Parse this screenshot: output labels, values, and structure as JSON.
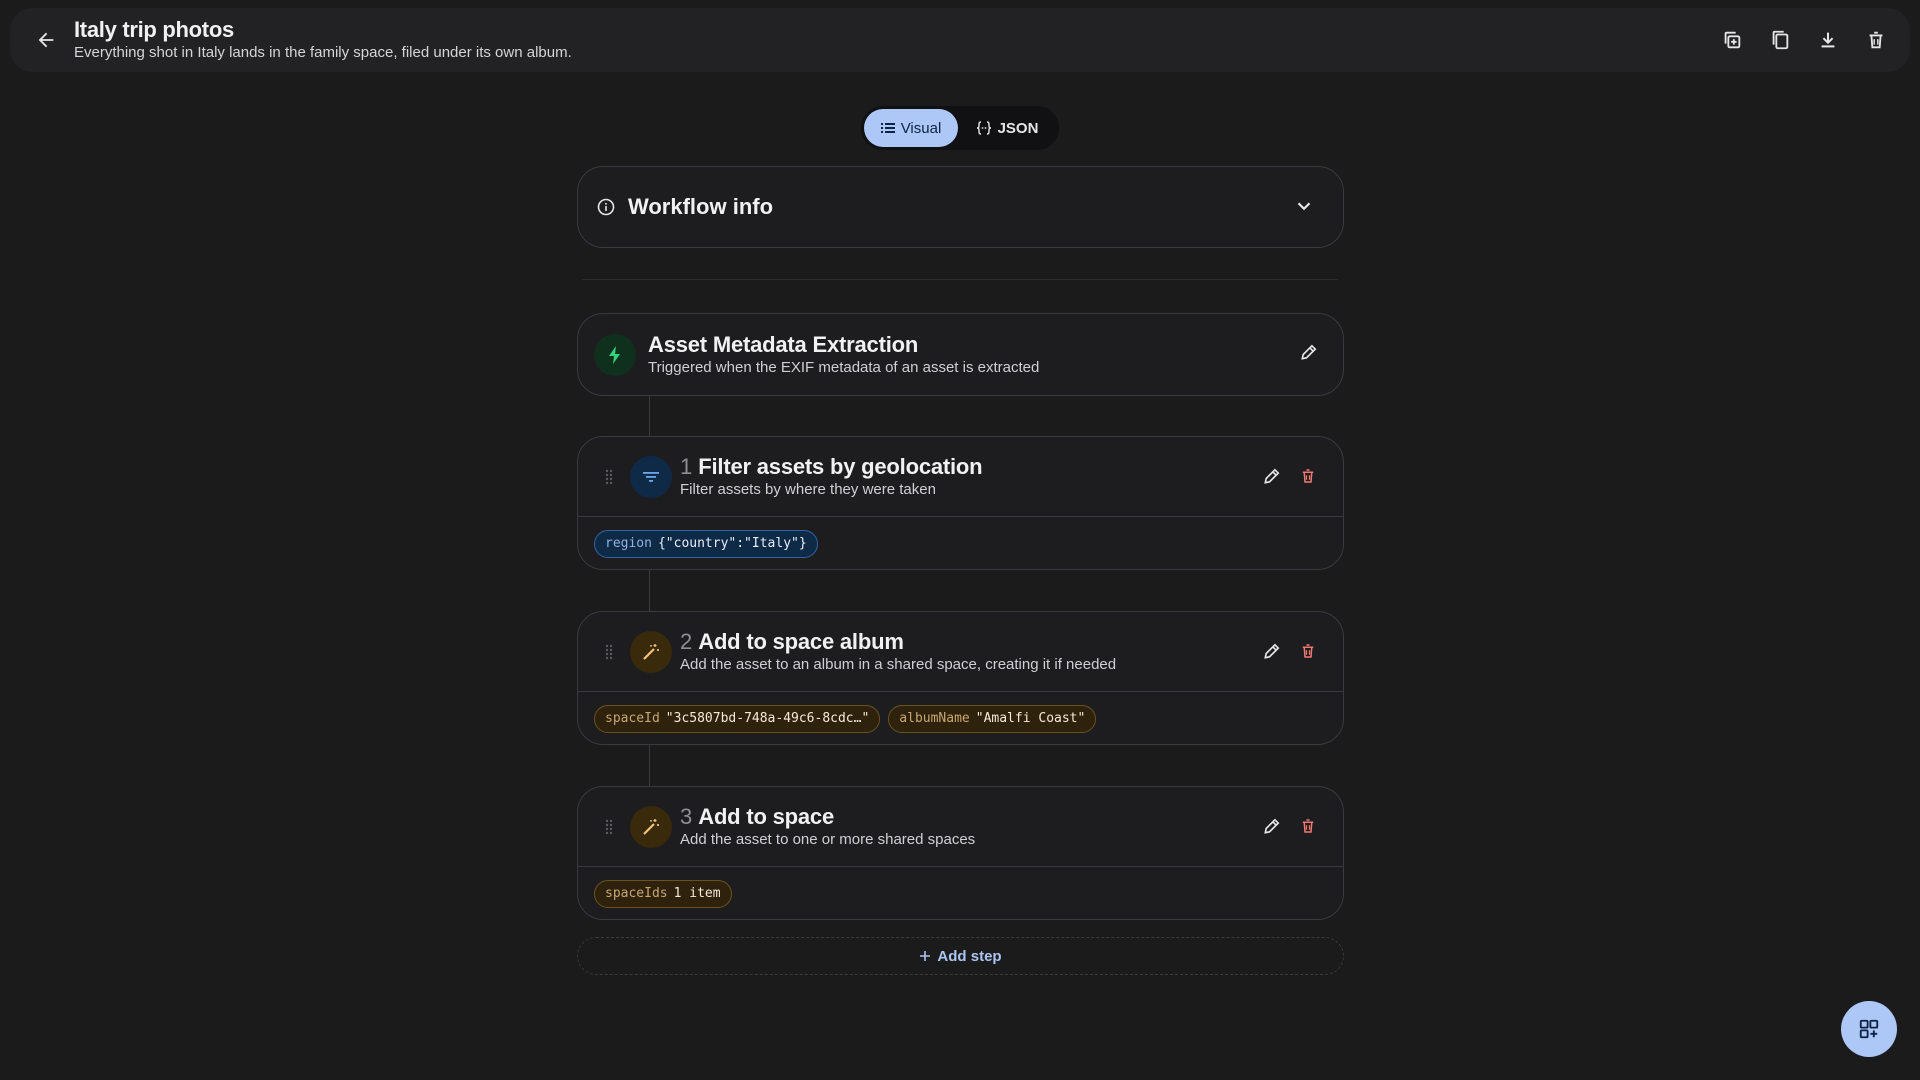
{
  "header": {
    "title": "Italy trip photos",
    "subtitle": "Everything shot in Italy lands in the family space, filed under its own album.",
    "icons": [
      "arrow-left-icon",
      "duplicate-icon",
      "copy-icon",
      "download-icon",
      "trash-icon"
    ]
  },
  "view_toggle": {
    "visual_label": "Visual",
    "json_label": "JSON",
    "selected": "Visual"
  },
  "workflow_info": {
    "title": "Workflow info"
  },
  "trigger": {
    "title": "Asset Metadata Extraction",
    "description": "Triggered when the EXIF metadata of an asset is extracted"
  },
  "steps": [
    {
      "number": "1",
      "title": "Filter assets by geolocation",
      "description": "Filter assets by where they were taken",
      "icon": "filter-icon",
      "params": [
        {
          "key": "region",
          "value": "{\"country\":\"Italy\"}"
        }
      ]
    },
    {
      "number": "2",
      "title": "Add to space album",
      "description": "Add the asset to an album in a shared space, creating it if needed",
      "icon": "magic-wand-icon",
      "params": [
        {
          "key": "spaceId",
          "value": "\"3c5807bd-748a-49c6-8cdc…\""
        },
        {
          "key": "albumName",
          "value": "\"Amalfi Coast\""
        }
      ]
    },
    {
      "number": "3",
      "title": "Add to space",
      "description": "Add the asset to one or more shared spaces",
      "icon": "magic-wand-icon",
      "params": [
        {
          "key": "spaceIds",
          "value": "1 item"
        }
      ]
    }
  ],
  "add_step": {
    "label": "Add step"
  },
  "colors": {
    "background": "#1b1b1c",
    "accent": "#adc7f7",
    "trigger_green": "#34d27a",
    "filter_blue": "#6aa6ec",
    "action_amber": "#f1c47a",
    "delete_red": "#f07a72"
  }
}
